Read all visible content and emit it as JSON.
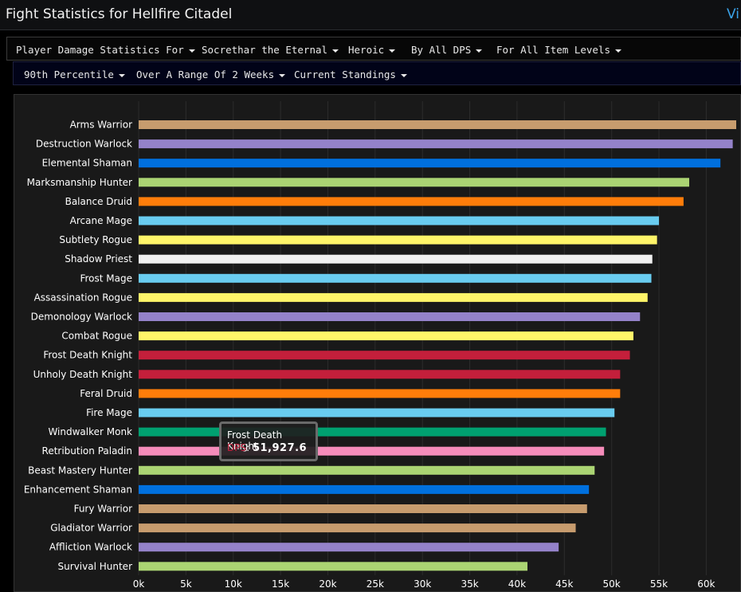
{
  "header": {
    "title": "Fight Statistics for Hellfire Citadel",
    "right_text": "Vi"
  },
  "filters_row1": [
    "Player Damage Statistics For",
    "Socrethar the Eternal",
    "Heroic",
    "By All DPS",
    "For All Item Levels"
  ],
  "filters_row2": [
    "90th Percentile",
    "Over A Range Of 2 Weeks",
    "Current Standings"
  ],
  "tooltip": {
    "name": "Frost Death Knight",
    "label": "DPS",
    "value": "51,927.6"
  },
  "chart_data": {
    "type": "bar",
    "orientation": "horizontal",
    "xlim": [
      0,
      63000
    ],
    "xticks": [
      "0k",
      "5k",
      "10k",
      "15k",
      "20k",
      "25k",
      "30k",
      "35k",
      "40k",
      "45k",
      "50k",
      "55k",
      "60k"
    ],
    "grid": true,
    "categories": [
      "Arms Warrior",
      "Destruction Warlock",
      "Elemental Shaman",
      "Marksmanship Hunter",
      "Balance Druid",
      "Arcane Mage",
      "Subtlety Rogue",
      "Shadow Priest",
      "Frost Mage",
      "Assassination Rogue",
      "Demonology Warlock",
      "Combat Rogue",
      "Frost Death Knight",
      "Unholy Death Knight",
      "Feral Druid",
      "Fire Mage",
      "Windwalker Monk",
      "Retribution Paladin",
      "Beast Mastery Hunter",
      "Enhancement Shaman",
      "Fury Warrior",
      "Gladiator Warrior",
      "Affliction Warlock",
      "Survival Hunter"
    ],
    "values": [
      63200,
      62800,
      61500,
      58200,
      57600,
      55000,
      54800,
      54300,
      54200,
      53800,
      53000,
      52300,
      51927.6,
      50900,
      50900,
      50300,
      49400,
      49200,
      48200,
      47600,
      47400,
      46200,
      44400,
      41100
    ],
    "colors": [
      "#c79c6e",
      "#9482c9",
      "#0070de",
      "#abd473",
      "#ff7d0a",
      "#69ccf0",
      "#fff569",
      "#f0f0f0",
      "#69ccf0",
      "#fff569",
      "#9482c9",
      "#fff569",
      "#c41f3b",
      "#c41f3b",
      "#ff7d0a",
      "#69ccf0",
      "#00a070",
      "#f58cba",
      "#abd473",
      "#0070de",
      "#c79c6e",
      "#c79c6e",
      "#9482c9",
      "#abd473"
    ]
  }
}
